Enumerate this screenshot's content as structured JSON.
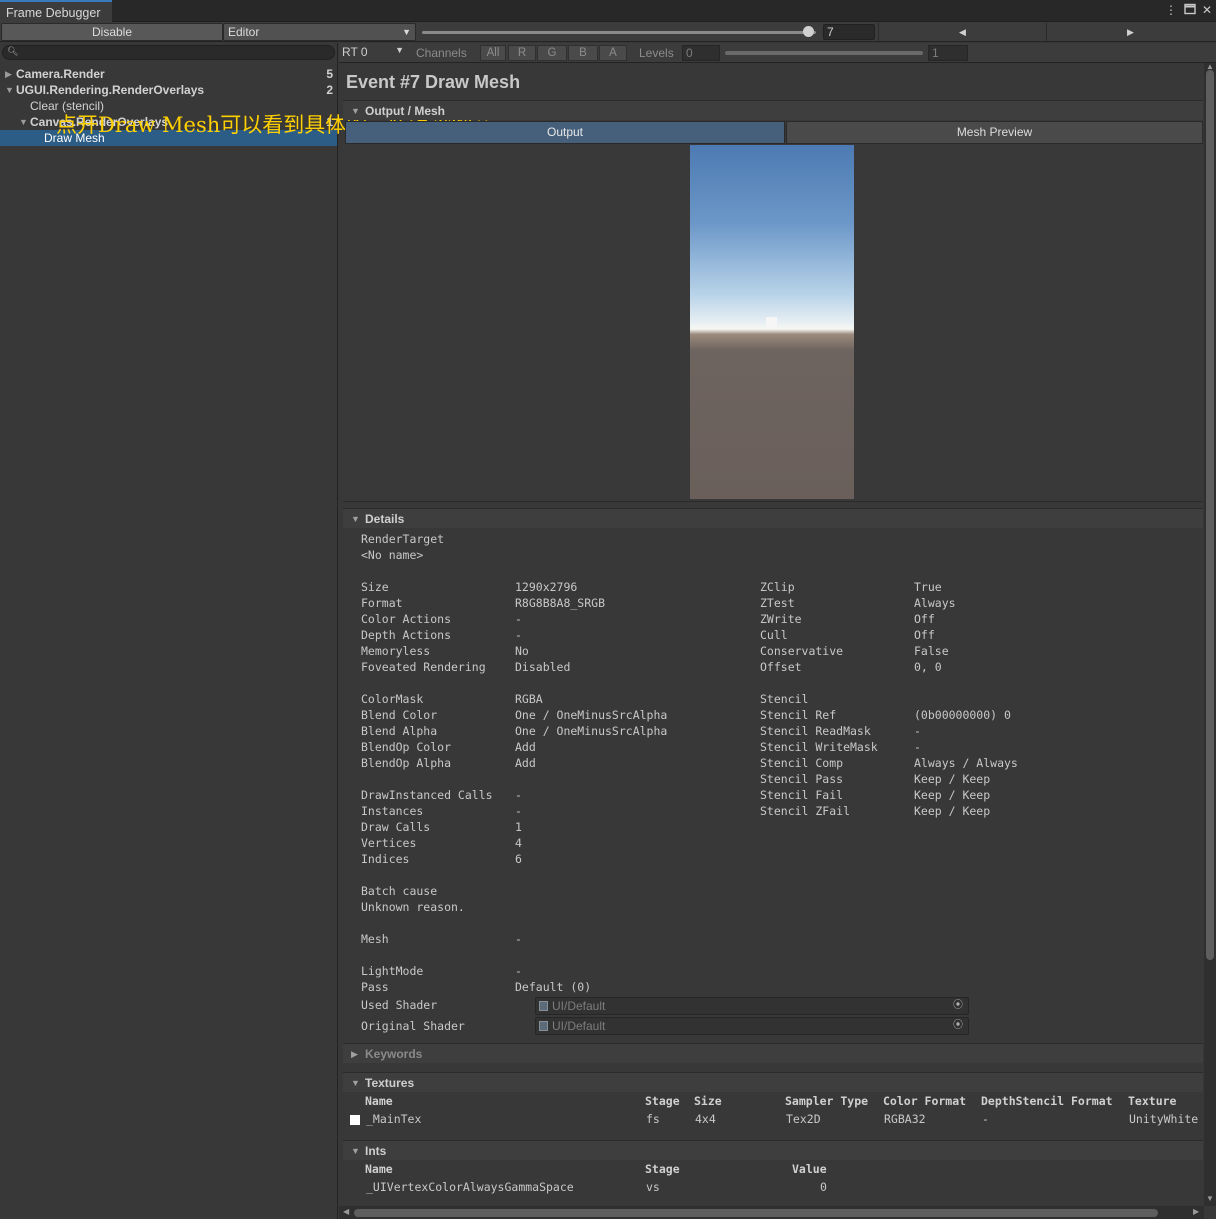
{
  "window": {
    "tab_title": "Frame Debugger",
    "menu_icon": "vertical-ellipsis-icon",
    "maximize_icon": "maximize-icon",
    "close_icon": "close-icon"
  },
  "toolbar": {
    "disable_label": "Disable",
    "target_label": "Editor",
    "event_index": "7",
    "event_fraction": 0.98,
    "prev_icon": "triangle-left-icon",
    "next_icon": "triangle-right-icon"
  },
  "tree": {
    "search_placeholder": "",
    "items": [
      {
        "label": "Camera.Render",
        "count": "5"
      },
      {
        "label": "UGUI.Rendering.RenderOverlays",
        "count": "2"
      },
      {
        "label": "Clear (stencil)",
        "count": ""
      },
      {
        "label": "Canvas.RenderOverlays",
        "count": "1"
      },
      {
        "label": "Draw Mesh",
        "count": ""
      }
    ],
    "annotation": "点开Draw Mesh可以看到具体的一些渲染细节"
  },
  "rt_toolbar": {
    "rt_label": "RT 0",
    "channels_label": "Channels",
    "channels": [
      "All",
      "R",
      "G",
      "B",
      "A"
    ],
    "levels_label": "Levels",
    "levels_min": "0",
    "levels_max": "1"
  },
  "event": {
    "title": "Event #7 Draw Mesh",
    "output_section": "Output / Mesh",
    "tab_output": "Output",
    "tab_mesh_preview": "Mesh Preview"
  },
  "details": {
    "section": "Details",
    "render_target_label": "RenderTarget",
    "render_target_value": "<No name>",
    "left": [
      {
        "label": "Size",
        "value": "1290x2796"
      },
      {
        "label": "Format",
        "value": "R8G8B8A8_SRGB"
      },
      {
        "label": "Color Actions",
        "value": "-"
      },
      {
        "label": "Depth Actions",
        "value": "-"
      },
      {
        "label": "Memoryless",
        "value": "No"
      },
      {
        "label": "Foveated Rendering",
        "value": "Disabled"
      },
      {
        "label": "ColorMask",
        "value": "RGBA"
      },
      {
        "label": "Blend Color",
        "value": "One / OneMinusSrcAlpha"
      },
      {
        "label": "Blend Alpha",
        "value": "One / OneMinusSrcAlpha"
      },
      {
        "label": "BlendOp Color",
        "value": "Add"
      },
      {
        "label": "BlendOp Alpha",
        "value": "Add"
      },
      {
        "label": "DrawInstanced Calls",
        "value": "-"
      },
      {
        "label": "Instances",
        "value": "-"
      },
      {
        "label": "Draw Calls",
        "value": "1"
      },
      {
        "label": "Vertices",
        "value": "4"
      },
      {
        "label": "Indices",
        "value": "6"
      }
    ],
    "right": [
      {
        "label": "ZClip",
        "value": "True"
      },
      {
        "label": "ZTest",
        "value": "Always"
      },
      {
        "label": "ZWrite",
        "value": "Off"
      },
      {
        "label": "Cull",
        "value": "Off"
      },
      {
        "label": "Conservative",
        "value": "False"
      },
      {
        "label": "Offset",
        "value": "0, 0"
      },
      {
        "label": "Stencil",
        "value": ""
      },
      {
        "label": "Stencil Ref",
        "value": "(0b00000000) 0"
      },
      {
        "label": "Stencil ReadMask",
        "value": "-"
      },
      {
        "label": "Stencil WriteMask",
        "value": "-"
      },
      {
        "label": "Stencil Comp",
        "value": "Always / Always"
      },
      {
        "label": "Stencil Pass",
        "value": "Keep / Keep"
      },
      {
        "label": "Stencil Fail",
        "value": "Keep / Keep"
      },
      {
        "label": "Stencil ZFail",
        "value": "Keep / Keep"
      }
    ],
    "batch_cause_label": "Batch cause",
    "batch_cause_value": "Unknown reason.",
    "mesh_label": "Mesh",
    "mesh_value": "-",
    "lightmode_label": "LightMode",
    "lightmode_value": "-",
    "pass_label": "Pass",
    "pass_value": "Default (0)",
    "used_shader_label": "Used Shader",
    "used_shader_value": "UI/Default",
    "original_shader_label": "Original Shader",
    "original_shader_value": "UI/Default"
  },
  "keywords": {
    "section": "Keywords"
  },
  "textures": {
    "section": "Textures",
    "headers": [
      "Name",
      "Stage",
      "Size",
      "Sampler Type",
      "Color Format",
      "DepthStencil Format",
      "Texture"
    ],
    "rows": [
      {
        "name": "_MainTex",
        "stage": "fs",
        "size": "4x4",
        "sampler": "Tex2D",
        "color_format": "RGBA32",
        "depth_format": "-",
        "texture": "UnityWhite"
      }
    ]
  },
  "ints": {
    "section": "Ints",
    "headers": [
      "Name",
      "Stage",
      "Value"
    ],
    "rows": [
      {
        "name": "_UIVertexColorAlwaysGammaSpace",
        "stage": "vs",
        "value": "0"
      }
    ]
  },
  "colors": {
    "selection": "#2c5d87",
    "output_tab": "#46607c",
    "annotation": "#ffd000",
    "window_accent": "#3a79bb"
  }
}
